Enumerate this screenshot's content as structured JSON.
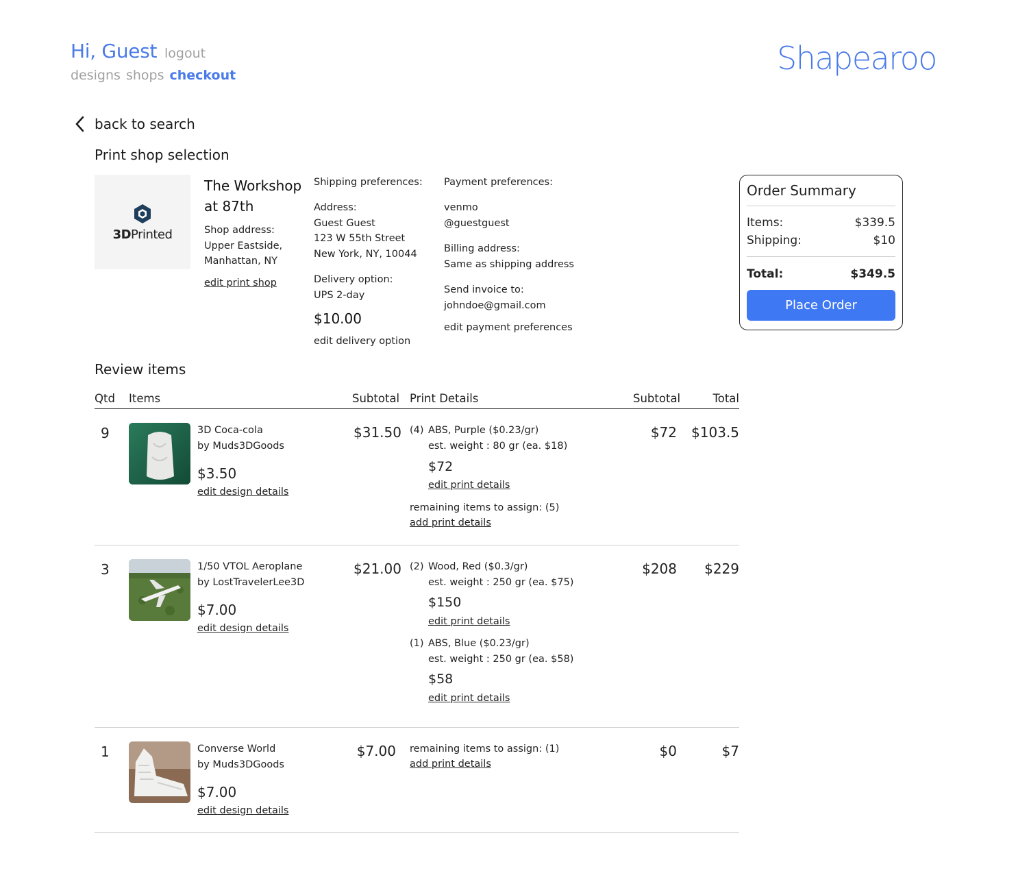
{
  "header": {
    "greeting": "Hi, Guest",
    "logout": "logout",
    "nav": [
      "designs",
      "shops",
      "checkout"
    ],
    "brand": "Shapearoo"
  },
  "back_label": "back to search",
  "shop_section": {
    "title": "Print shop selection",
    "logo_text_bold": "3D",
    "logo_text_light": "Printed",
    "name_line1": "The Workshop",
    "name_line2": "at 87th",
    "address_label": "Shop address:",
    "address_line1": "Upper Eastside,",
    "address_line2": "Manhattan, NY",
    "edit_link": "edit print shop"
  },
  "shipping": {
    "title": "Shipping preferences:",
    "address_label": "Address:",
    "address_lines": [
      "Guest Guest",
      "123 W 55th Street",
      "New York, NY, 10044"
    ],
    "delivery_label": "Delivery option:",
    "delivery_value": "UPS 2-day",
    "delivery_price": "$10.00",
    "edit_link": "edit delivery option"
  },
  "payment": {
    "title": "Payment preferences:",
    "method": "venmo",
    "handle": "@guestguest",
    "billing_label": "Billing address:",
    "billing_value": "Same as shipping address",
    "invoice_label": "Send invoice to:",
    "invoice_value": "johndoe@gmail.com",
    "edit_link": "edit payment preferences"
  },
  "summary": {
    "title": "Order Summary",
    "items_label": "Items:",
    "items_value": "$339.5",
    "shipping_label": "Shipping:",
    "shipping_value": "$10",
    "total_label": "Total:",
    "total_value": "$349.5",
    "button": "Place Order"
  },
  "review": {
    "title": "Review items",
    "columns": [
      "Qtd",
      "Items",
      "Subtotal",
      "Print Details",
      "Subtotal",
      "Total"
    ],
    "rows": [
      {
        "qty": "9",
        "name": "3D Coca-cola",
        "by": "by Muds3DGoods",
        "price": "$3.50",
        "edit_design": "edit design details",
        "subtotal": "$31.50",
        "details": [
          {
            "count": "(4)",
            "material": "ABS, Purple ($0.23/gr)",
            "weight": "est. weight : 80 gr (ea. $18)",
            "price": "$72",
            "edit": "edit print details"
          }
        ],
        "remaining": "remaining items to assign: (5)",
        "add_link": "add print details",
        "print_subtotal": "$72",
        "total": "$103.5"
      },
      {
        "qty": "3",
        "name": "1/50 VTOL Aeroplane",
        "by": "by LostTravelerLee3D",
        "price": "$7.00",
        "edit_design": "edit design details",
        "subtotal": "$21.00",
        "details": [
          {
            "count": "(2)",
            "material": "Wood, Red ($0.3/gr)",
            "weight": "est. weight : 250 gr (ea. $75)",
            "price": "$150",
            "edit": "edit print details"
          },
          {
            "count": "(1)",
            "material": "ABS, Blue ($0.23/gr)",
            "weight": "est. weight : 250 gr (ea. $58)",
            "price": "$58",
            "edit": "edit print details"
          }
        ],
        "print_subtotal": "$208",
        "total": "$229"
      },
      {
        "qty": "1",
        "name": "Converse World",
        "by": "by Muds3DGoods",
        "price": "$7.00",
        "edit_design": "edit design details",
        "subtotal": "$7.00",
        "remaining": "remaining items to assign: (1)",
        "add_link": "add print details",
        "print_subtotal": "$0",
        "total": "$7"
      }
    ]
  }
}
